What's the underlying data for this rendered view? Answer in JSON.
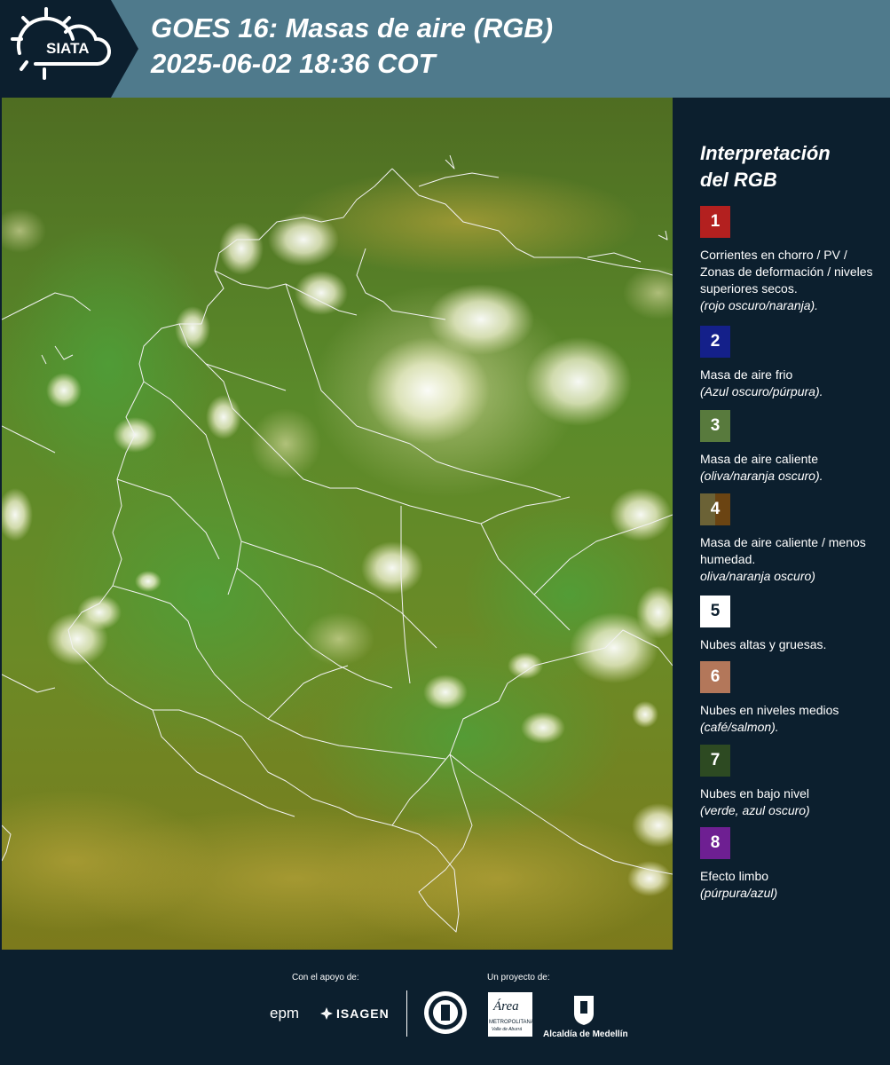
{
  "header": {
    "logo_text": "SIATA",
    "title_line1": "GOES 16: Masas de aire (RGB)",
    "title_line2": " 2025-06-02 18:36 COT"
  },
  "legend": {
    "title_line1": "Interpretación",
    "title_line2": "del RGB",
    "items": [
      {
        "num": "1",
        "color": "#b3201f",
        "text": "Corrientes en chorro / PV / Zonas de deformación / niveles superiores secos.",
        "note": "(rojo oscuro/naranja)."
      },
      {
        "num": "2",
        "color": "#14208a",
        "text": "Masa de aire frio",
        "note": "(Azul oscuro/púrpura)."
      },
      {
        "num": "3",
        "color": "#587a3d",
        "text": "Masa de aire caliente",
        "note": "(oliva/naranja oscuro)."
      },
      {
        "num": "4",
        "color": "#6b6236",
        "color2": "#6b4412",
        "text": "Masa de aire caliente / menos humedad.",
        "note": "oliva/naranja oscuro)"
      },
      {
        "num": "5",
        "color": "#ffffff",
        "text": "Nubes altas y gruesas.",
        "note": ""
      },
      {
        "num": "6",
        "color": "#b3775a",
        "text": "Nubes en niveles medios",
        "note": "(café/salmon)."
      },
      {
        "num": "7",
        "color": "#2d4a22",
        "text": "Nubes en bajo nivel",
        "note": "(verde, azul oscuro)"
      },
      {
        "num": "8",
        "color": "#6e1f92",
        "text": "Efecto limbo",
        "note": "(púrpura/azul)"
      }
    ]
  },
  "footer": {
    "support_label": "Con el apoyo de:",
    "project_label": "Un proyecto de:",
    "sponsor1": "epm",
    "sponsor2": "ISAGEN",
    "partner_area_1": "Área",
    "partner_area_2": "METROPOLITANA",
    "partner_area_3": "Valle de Aburrá",
    "partner_alcaldia": "Alcaldía de Medellín"
  }
}
